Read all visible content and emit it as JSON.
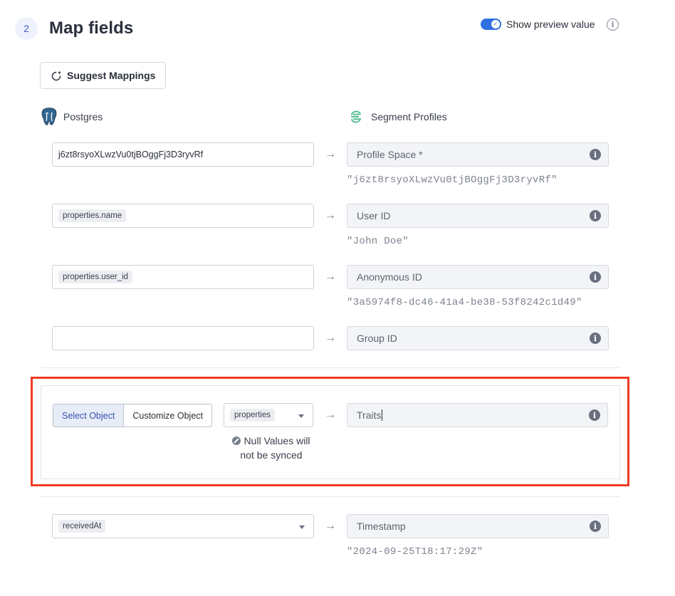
{
  "header": {
    "step_number": "2",
    "title": "Map fields",
    "preview_toggle_label": "Show preview value",
    "preview_toggle_on": true
  },
  "suggest_button": {
    "label": "Suggest Mappings"
  },
  "source": {
    "name": "Postgres",
    "icon": "postgres-elephant-icon"
  },
  "destination": {
    "name": "Segment Profiles",
    "icon": "segment-logo-icon"
  },
  "mappings": [
    {
      "source_value": "j6zt8rsyoXLwzVu0tjBOggFj3D3ryvRf",
      "source_chip": false,
      "destination": "Profile Space *",
      "preview": "\"j6zt8rsyoXLwzVu0tjBOggFj3D3ryvRf\""
    },
    {
      "source_value": "properties.name",
      "source_chip": true,
      "destination": "User ID",
      "preview": "\"John Doe\""
    },
    {
      "source_value": "properties.user_id",
      "source_chip": true,
      "destination": "Anonymous ID",
      "preview": "\"3a5974f8-dc46-41a4-be38-53f8242c1d49\""
    },
    {
      "source_value": "",
      "source_chip": false,
      "destination": "Group ID",
      "preview": ""
    }
  ],
  "traits": {
    "mode_options": [
      "Select Object",
      "Customize Object"
    ],
    "active_mode": "Select Object",
    "object_value": "properties",
    "null_note": "Null Values will not be synced",
    "destination": "Traits"
  },
  "timestamp": {
    "source_value": "receivedAt",
    "destination": "Timestamp",
    "preview": "\"2024-09-25T18:17:29Z\""
  },
  "colors": {
    "accent": "#2f6fe0",
    "highlight_frame": "#ee3b24"
  }
}
